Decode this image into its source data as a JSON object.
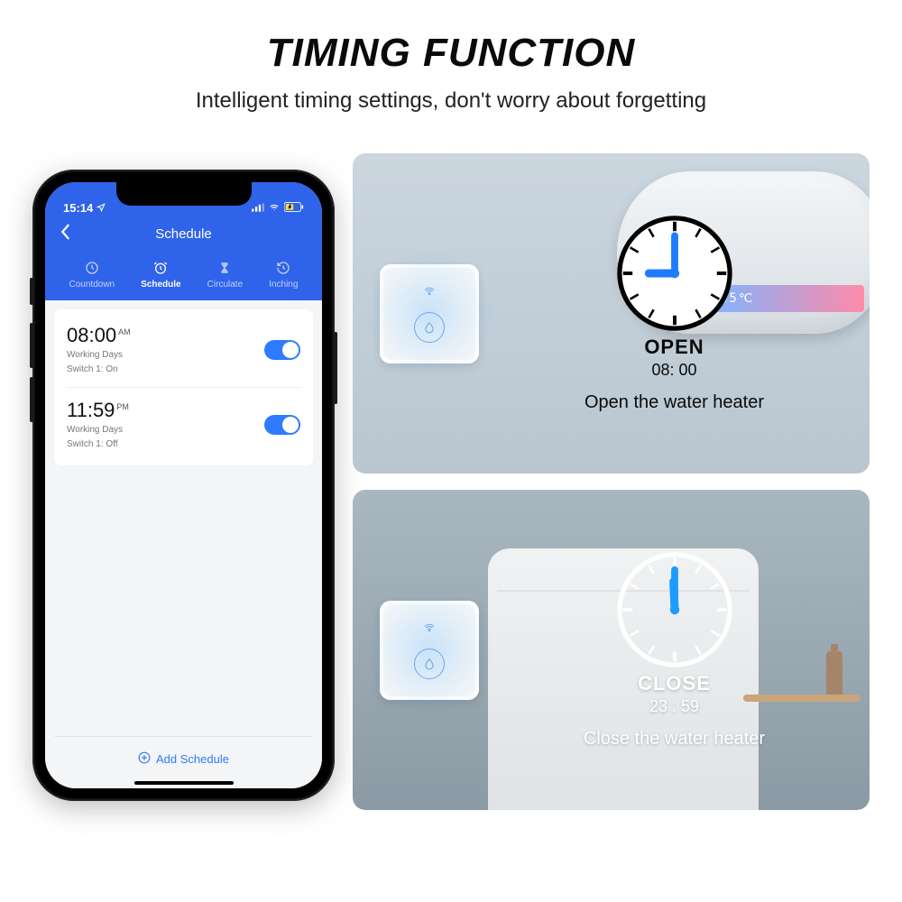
{
  "headline": "TIMING FUNCTION",
  "subtitle": "Intelligent timing settings, don't worry about forgetting",
  "phone": {
    "status_time": "15:14",
    "title": "Schedule",
    "tabs": [
      {
        "label": "Countdown"
      },
      {
        "label": "Schedule"
      },
      {
        "label": "Circulate"
      },
      {
        "label": "Inching"
      }
    ],
    "schedules": [
      {
        "time": "08:00",
        "ampm": "AM",
        "days": "Working Days",
        "state": "Switch 1: On"
      },
      {
        "time": "11:59",
        "ampm": "PM",
        "days": "Working Days",
        "state": "Switch 1: Off"
      }
    ],
    "add_label": "Add Schedule"
  },
  "panels": {
    "open": {
      "label": "OPEN",
      "time": "08: 00",
      "desc": "Open the water heater",
      "temp": "45℃"
    },
    "close": {
      "label": "CLOSE",
      "time": "23 : 59",
      "desc": "Close the water heater"
    }
  }
}
